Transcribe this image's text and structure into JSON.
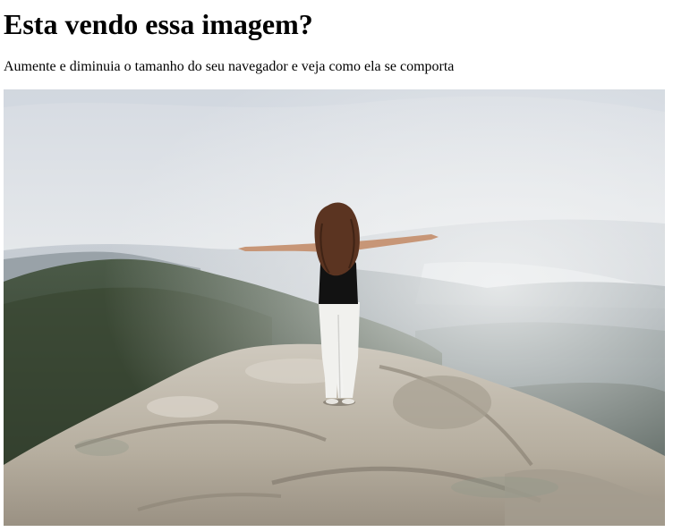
{
  "page": {
    "title": "Esta vendo essa imagem?",
    "subtitle": "Aumente e diminuia o tamanho do seu navegador e veja como ela se comporta"
  },
  "photo": {
    "description": "woman-with-outstretched-arms-on-mountain-summit",
    "colors": {
      "sky_top": "#d9dde3",
      "sky_bottom": "#eef0f1",
      "far_hills": "#aab3bd",
      "mid_hills": "#6f7d82",
      "forest": "#3e4c3c",
      "rock_light": "#c9c2b6",
      "rock_shadow": "#8c8479",
      "hair": "#5a3420",
      "top": "#111111",
      "pants": "#f4f4f2",
      "skin": "#c99a7c"
    }
  }
}
